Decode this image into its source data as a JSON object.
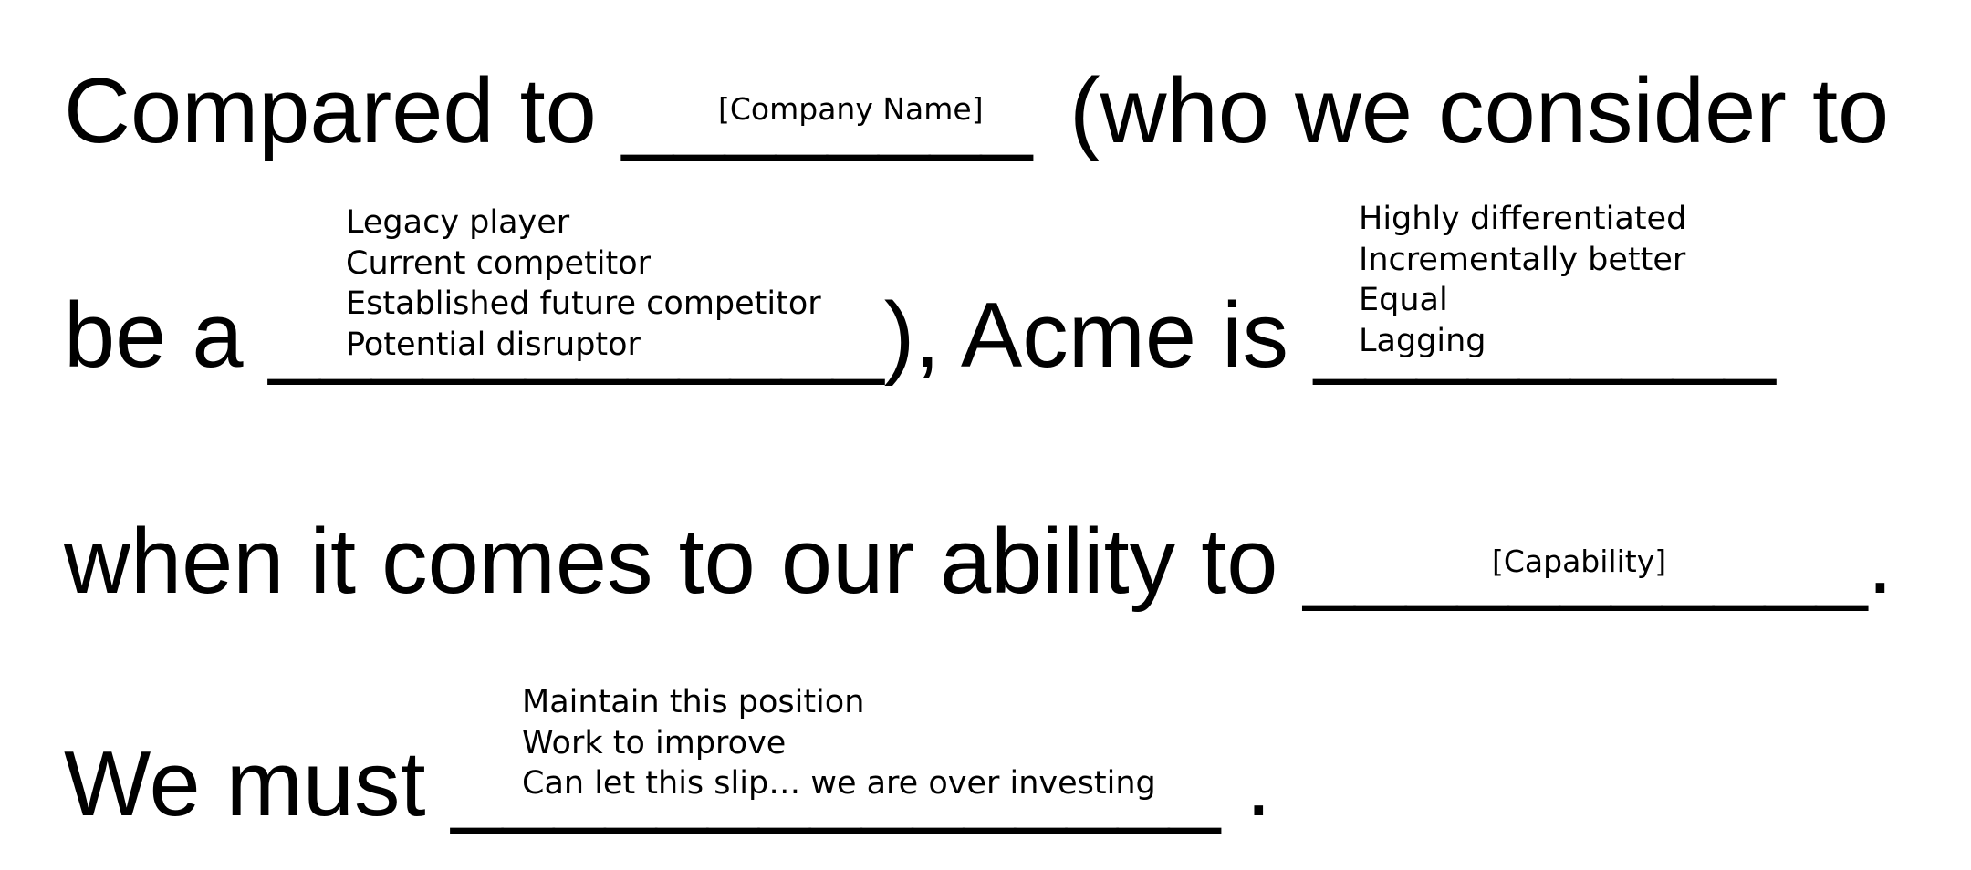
{
  "sentence": {
    "line1": {
      "before": "Compared to ________",
      "after": "(who we consider to"
    },
    "line2": {
      "before": "be a ____________), Acme is _________"
    },
    "line3": {
      "before": "when it comes to our ability to ___________."
    },
    "line4": {
      "before": "We must _______________ ."
    }
  },
  "blanks": {
    "company_name": "[Company Name]",
    "competitor_type": {
      "options": [
        "Legacy player",
        "Current competitor",
        "Established future competitor",
        "Potential disruptor"
      ]
    },
    "position": {
      "options": [
        "Highly differentiated",
        "Incrementally better",
        "Equal",
        "Lagging"
      ]
    },
    "capability": "[Capability]",
    "action": {
      "options": [
        "Maintain this position",
        "Work to improve",
        "Can let this slip… we are over investing"
      ]
    }
  }
}
